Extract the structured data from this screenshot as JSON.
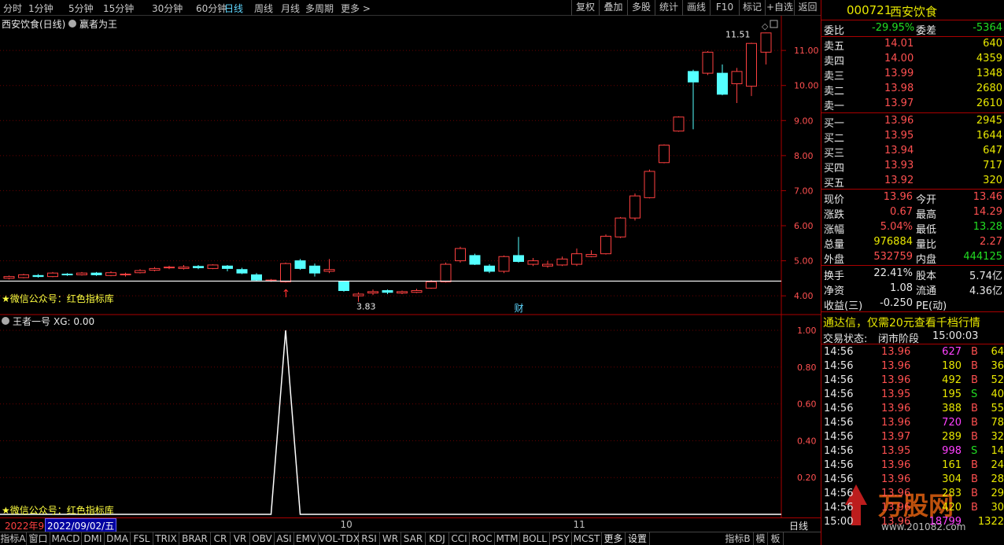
{
  "toolbar": {
    "periods": [
      "分时",
      "1分钟",
      "5分钟",
      "15分钟",
      "30分钟",
      "60分钟",
      "日线",
      "周线",
      "月线",
      "多周期",
      "更多 >"
    ],
    "active_period": "日线",
    "buttons": [
      "复权",
      "叠加",
      "多股",
      "统计",
      "画线",
      "F10",
      "标记",
      "+自选",
      "返回"
    ]
  },
  "chart": {
    "title": "西安饮食(日线)",
    "indicator_name": "赢者为王",
    "watermark_label": "★微信公众号：红色指标库",
    "high_label": "11.51",
    "low_label": "3.83",
    "finance_marker": "财",
    "price_ticks": [
      "11.00",
      "10.00",
      "9.00",
      "8.00",
      "7.00",
      "6.00",
      "5.00",
      "4.00"
    ],
    "price_values": [
      11,
      10,
      9,
      8,
      7,
      6,
      5,
      4
    ],
    "month_labels": [
      "10",
      "11"
    ],
    "date_left": "2022年9",
    "date_cursor": "2022/09/02/五",
    "period_label": "日线"
  },
  "chart_data": {
    "type": "candlestick",
    "ylim": [
      3.6,
      11.9
    ],
    "support_line": 4.42,
    "candles": [
      [
        4.5,
        4.55,
        4.58,
        4.47
      ],
      [
        4.52,
        4.6,
        4.63,
        4.5
      ],
      [
        4.58,
        4.55,
        4.62,
        4.52
      ],
      [
        4.55,
        4.65,
        4.68,
        4.53
      ],
      [
        4.62,
        4.6,
        4.65,
        4.57
      ],
      [
        4.6,
        4.65,
        4.68,
        4.58
      ],
      [
        4.65,
        4.6,
        4.68,
        4.57
      ],
      [
        4.58,
        4.66,
        4.7,
        4.56
      ],
      [
        4.62,
        4.62,
        4.66,
        4.55
      ],
      [
        4.66,
        4.72,
        4.76,
        4.64
      ],
      [
        4.73,
        4.78,
        4.82,
        4.7
      ],
      [
        4.8,
        4.82,
        4.86,
        4.76
      ],
      [
        4.78,
        4.82,
        4.88,
        4.75
      ],
      [
        4.84,
        4.8,
        4.88,
        4.76
      ],
      [
        4.78,
        4.88,
        4.9,
        4.76
      ],
      [
        4.85,
        4.78,
        4.88,
        4.7
      ],
      [
        4.75,
        4.65,
        4.8,
        4.62
      ],
      [
        4.6,
        4.45,
        4.65,
        4.42
      ],
      [
        4.45,
        4.45,
        4.48,
        4.4
      ],
      [
        4.4,
        4.92,
        4.95,
        4.38
      ],
      [
        5.0,
        4.78,
        5.05,
        4.74
      ],
      [
        4.85,
        4.65,
        4.92,
        4.55
      ],
      [
        4.7,
        4.75,
        5.05,
        4.65
      ],
      [
        4.4,
        4.15,
        4.42,
        4.12
      ],
      [
        4.0,
        4.05,
        4.1,
        3.83
      ],
      [
        4.08,
        4.12,
        4.18,
        4.02
      ],
      [
        4.15,
        4.1,
        4.18,
        4.05
      ],
      [
        4.08,
        4.12,
        4.15,
        4.05
      ],
      [
        4.1,
        4.15,
        4.2,
        4.08
      ],
      [
        4.22,
        4.4,
        4.45,
        4.2
      ],
      [
        4.4,
        4.9,
        4.95,
        4.38
      ],
      [
        5.0,
        5.35,
        5.4,
        4.95
      ],
      [
        5.15,
        4.9,
        5.2,
        4.88
      ],
      [
        4.85,
        4.7,
        4.9,
        4.65
      ],
      [
        4.7,
        5.12,
        5.15,
        4.65
      ],
      [
        5.15,
        4.98,
        5.68,
        4.95
      ],
      [
        4.9,
        5.0,
        5.08,
        4.85
      ],
      [
        4.85,
        4.9,
        5.0,
        4.8
      ],
      [
        4.88,
        5.05,
        5.12,
        4.85
      ],
      [
        4.9,
        5.2,
        5.35,
        4.85
      ],
      [
        5.12,
        5.18,
        5.3,
        5.1
      ],
      [
        5.2,
        5.7,
        5.75,
        5.18
      ],
      [
        5.68,
        6.22,
        6.25,
        5.65
      ],
      [
        6.22,
        6.85,
        6.92,
        6.15
      ],
      [
        6.8,
        7.55,
        7.6,
        6.78
      ],
      [
        7.8,
        8.3,
        8.32,
        7.78
      ],
      [
        8.7,
        9.1,
        9.12,
        8.68
      ],
      [
        10.4,
        10.1,
        10.45,
        8.75
      ],
      [
        10.35,
        10.95,
        10.98,
        10.3
      ],
      [
        10.35,
        9.75,
        10.6,
        9.72
      ],
      [
        10.05,
        10.4,
        10.5,
        9.5
      ],
      [
        9.98,
        11.2,
        11.22,
        9.7
      ],
      [
        10.95,
        11.5,
        11.51,
        10.6
      ]
    ],
    "indicator_series": [
      {
        "name": "XG",
        "values": [
          0,
          0,
          0,
          0,
          0,
          0,
          0,
          0,
          0,
          0,
          0,
          0,
          0,
          0,
          0,
          0,
          0,
          0,
          0,
          1,
          0,
          0,
          0,
          0,
          0,
          0,
          0,
          0,
          0,
          0,
          0,
          0,
          0,
          0,
          0,
          0,
          0,
          0,
          0,
          0,
          0,
          0,
          0,
          0,
          0,
          0,
          0,
          0,
          0,
          0,
          0,
          0,
          0
        ]
      }
    ],
    "indicator_ticks": [
      "1.00",
      "0.80",
      "0.60",
      "0.40",
      "0.20"
    ],
    "indicator_values": [
      1.0,
      0.8,
      0.6,
      0.4,
      0.2
    ]
  },
  "indicator": {
    "title": "王者一号",
    "xg_label": "XG: 0.00",
    "watermark_label": "★微信公众号：红色指标库"
  },
  "bottom": {
    "tabs": [
      "指标A",
      "窗口",
      "MACD",
      "DMI",
      "DMA",
      "FSL",
      "TRIX",
      "BRAR",
      "CR",
      "VR",
      "OBV",
      "ASI",
      "EMV",
      "VOL-TDX",
      "RSI",
      "WR",
      "SAR",
      "KDJ",
      "CCI",
      "ROC",
      "MTM",
      "BOLL",
      "PSY",
      "MCST",
      "更多",
      "设置"
    ],
    "right_tabs": [
      "指标B",
      "模",
      "板"
    ]
  },
  "panel": {
    "code": "000721",
    "name": "西安饮食",
    "weibi_label": "委比",
    "weibi_value": "-29.95%",
    "weicha_label": "委差",
    "weicha_value": "-5364",
    "asks": [
      {
        "label": "卖五",
        "price": "14.01",
        "vol": "640"
      },
      {
        "label": "卖四",
        "price": "14.00",
        "vol": "4359"
      },
      {
        "label": "卖三",
        "price": "13.99",
        "vol": "1348"
      },
      {
        "label": "卖二",
        "price": "13.98",
        "vol": "2680"
      },
      {
        "label": "卖一",
        "price": "13.97",
        "vol": "2610"
      }
    ],
    "bids": [
      {
        "label": "买一",
        "price": "13.96",
        "vol": "2945"
      },
      {
        "label": "买二",
        "price": "13.95",
        "vol": "1644"
      },
      {
        "label": "买三",
        "price": "13.94",
        "vol": "647"
      },
      {
        "label": "买四",
        "price": "13.93",
        "vol": "717"
      },
      {
        "label": "买五",
        "price": "13.92",
        "vol": "320"
      }
    ],
    "stats": [
      {
        "l1": "现价",
        "v1": "13.96",
        "l2": "今开",
        "v2": "13.46"
      },
      {
        "l1": "涨跌",
        "v1": "0.67",
        "l2": "最高",
        "v2": "14.29"
      },
      {
        "l1": "涨幅",
        "v1": "5.04%",
        "l2": "最低",
        "v2": "13.28"
      },
      {
        "l1": "总量",
        "v1": "976884",
        "l2": "量比",
        "v2": "2.27"
      },
      {
        "l1": "外盘",
        "v1": "532759",
        "l2": "内盘",
        "v2": "444125"
      }
    ],
    "fund": [
      {
        "l1": "换手",
        "v1": "22.41%",
        "l2": "股本",
        "v2": "5.74亿"
      },
      {
        "l1": "净资",
        "v1": "1.08",
        "l2": "流通",
        "v2": "4.36亿"
      },
      {
        "l1": "收益(三)",
        "v1": "-0.250",
        "l2": "PE(动)",
        "v2": ""
      }
    ],
    "ad_text": "通达信，仅需20元查看千档行情",
    "trade_status_label": "交易状态:",
    "trade_status_value": "闭市阶段",
    "trade_time": "15:00:03",
    "ticks": [
      {
        "time": "14:56",
        "price": "13.96",
        "vol": "627",
        "side": "B",
        "n": "64"
      },
      {
        "time": "14:56",
        "price": "13.96",
        "vol": "180",
        "side": "B",
        "n": "36"
      },
      {
        "time": "14:56",
        "price": "13.96",
        "vol": "492",
        "side": "B",
        "n": "52"
      },
      {
        "time": "14:56",
        "price": "13.95",
        "vol": "195",
        "side": "S",
        "n": "40"
      },
      {
        "time": "14:56",
        "price": "13.96",
        "vol": "388",
        "side": "B",
        "n": "55"
      },
      {
        "time": "14:56",
        "price": "13.96",
        "vol": "720",
        "side": "B",
        "n": "78"
      },
      {
        "time": "14:56",
        "price": "13.97",
        "vol": "289",
        "side": "B",
        "n": "32"
      },
      {
        "time": "14:56",
        "price": "13.95",
        "vol": "998",
        "side": "S",
        "n": "14"
      },
      {
        "time": "14:56",
        "price": "13.96",
        "vol": "161",
        "side": "B",
        "n": "24"
      },
      {
        "time": "14:56",
        "price": "13.96",
        "vol": "304",
        "side": "B",
        "n": "28"
      },
      {
        "time": "14:56",
        "price": "13.96",
        "vol": "283",
        "side": "B",
        "n": "29"
      },
      {
        "time": "14:56",
        "price": "13.96",
        "vol": "420",
        "side": "B",
        "n": "30"
      },
      {
        "time": "15:00",
        "price": "13.96",
        "vol": "18799",
        "side": "",
        "n": "1322"
      }
    ],
    "logo_text": "万股网",
    "logo_url": "www.201082.com"
  }
}
